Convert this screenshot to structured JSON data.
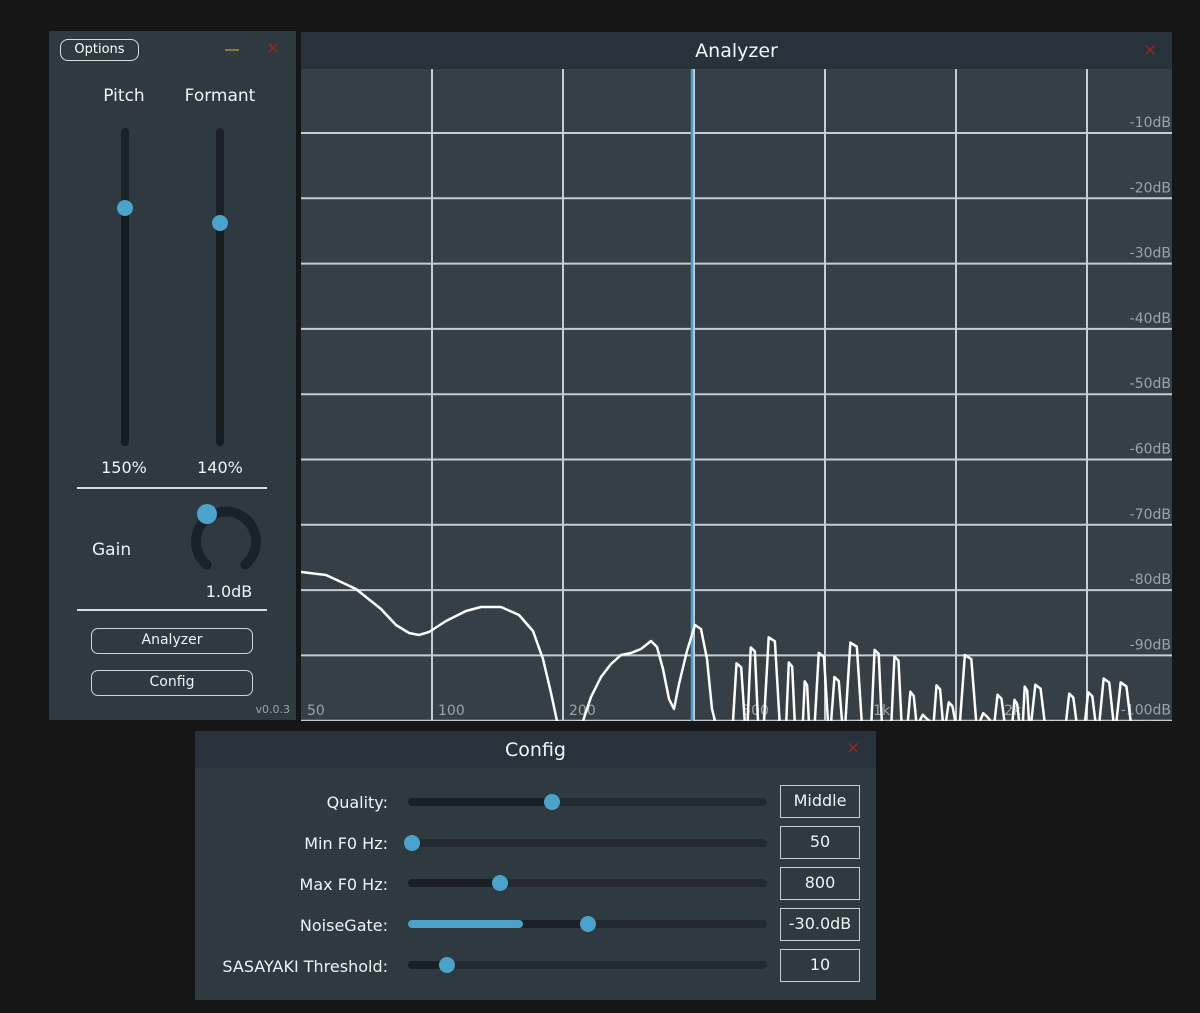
{
  "main_panel": {
    "options_label": "Options",
    "pitch": {
      "label": "Pitch",
      "value_text": "150%",
      "level": 0.75
    },
    "formant": {
      "label": "Formant",
      "value_text": "140%",
      "level": 0.7
    },
    "gain": {
      "label": "Gain",
      "value_text": "1.0dB"
    },
    "analyzer_button": "Analyzer",
    "config_button": "Config",
    "version": "v0.0.3"
  },
  "analyzer": {
    "title": "Analyzer",
    "db_labels": [
      "-10dB",
      "-20dB",
      "-30dB",
      "-40dB",
      "-50dB",
      "-60dB",
      "-70dB",
      "-80dB",
      "-90dB",
      "-100dB"
    ],
    "freq_labels": [
      "50",
      "100",
      "200",
      "500",
      "1k",
      "2k"
    ],
    "cursor_hz": 400,
    "colors": {
      "grid": "#c8ccd0",
      "cursor": "#4ba3cc",
      "curve": "#ffffff"
    }
  },
  "config": {
    "title": "Config",
    "rows": [
      {
        "label": "Quality:",
        "value": "Middle",
        "level": 0.4
      },
      {
        "label": "Min F0 Hz:",
        "value": "50",
        "level": 0.0
      },
      {
        "label": "Max F0 Hz:",
        "value": "800",
        "level": 0.25
      },
      {
        "label": "NoiseGate:",
        "value": "-30.0dB",
        "level": 0.5,
        "meter": 0.32
      },
      {
        "label": "SASAYAKI Threshold:",
        "value": "10",
        "level": 0.1
      }
    ]
  },
  "accent_color": "#4ba3cc"
}
